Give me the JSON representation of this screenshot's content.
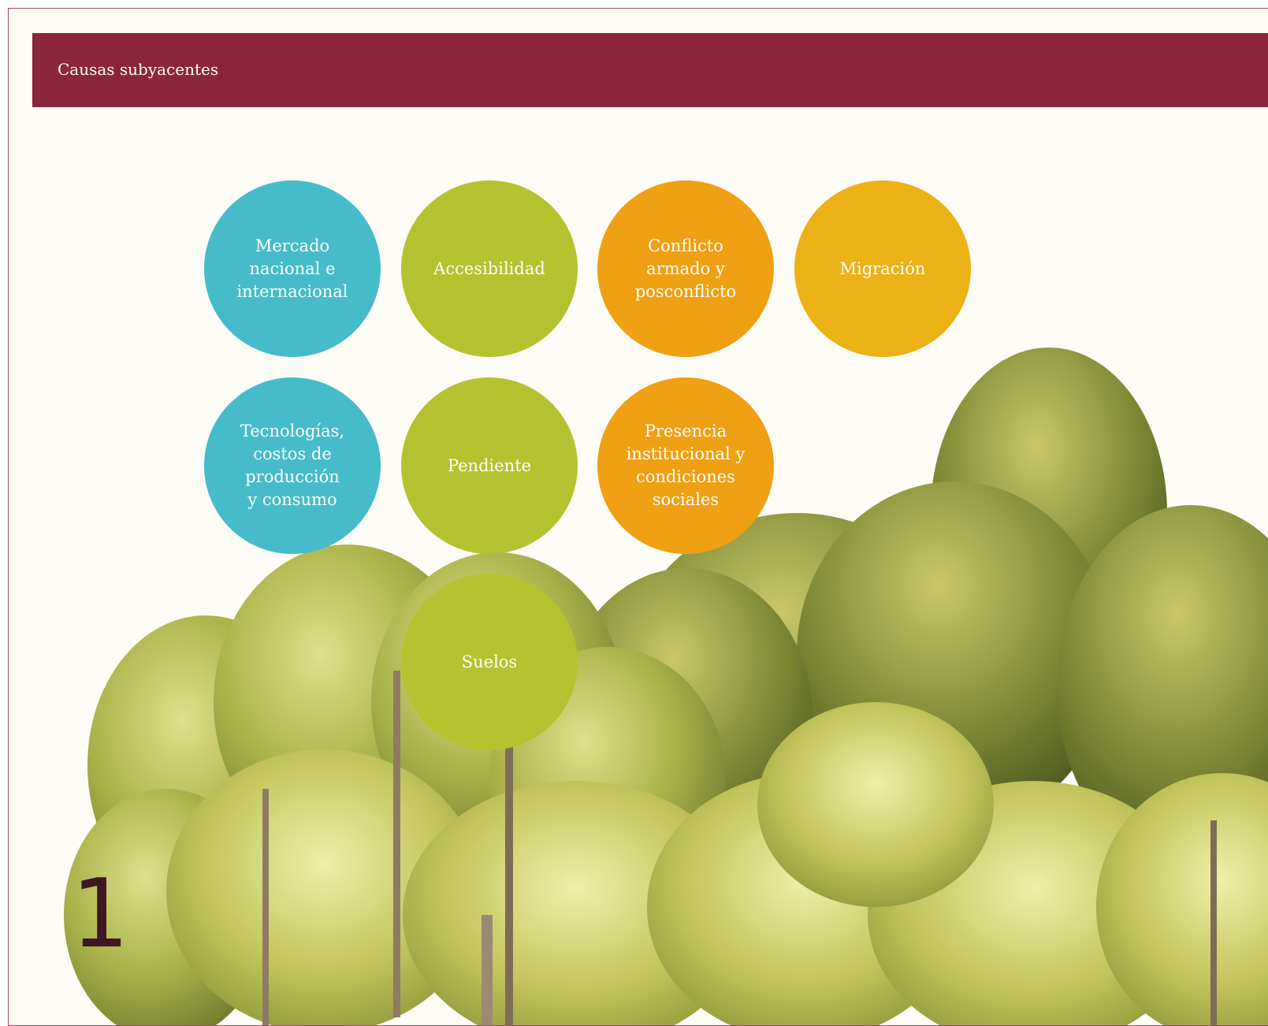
{
  "header": {
    "title": "Causas subyacentes"
  },
  "palette": {
    "band": "#8b253a",
    "blue": "#46bccb",
    "lime": "#b5c22f",
    "orange": "#f0a013",
    "amber": "#ecb115",
    "number": "#3f1622"
  },
  "causes": [
    {
      "label": "Mercado\nnacional e\ninternacional",
      "color": "blue"
    },
    {
      "label": "Accesibilidad",
      "color": "lime"
    },
    {
      "label": "Conflicto\narmado y\nposconflicto",
      "color": "orange"
    },
    {
      "label": "Migración",
      "color": "amber"
    },
    {
      "label": "Tecnologías,\ncostos de\nproducción\ny consumo",
      "color": "blue"
    },
    {
      "label": "Pendiente",
      "color": "lime"
    },
    {
      "label": "Presencia\ninstitucional y\ncondiciones\nsociales",
      "color": "orange"
    },
    {
      "label": "Suelos",
      "color": "lime"
    }
  ],
  "page_number": "1"
}
